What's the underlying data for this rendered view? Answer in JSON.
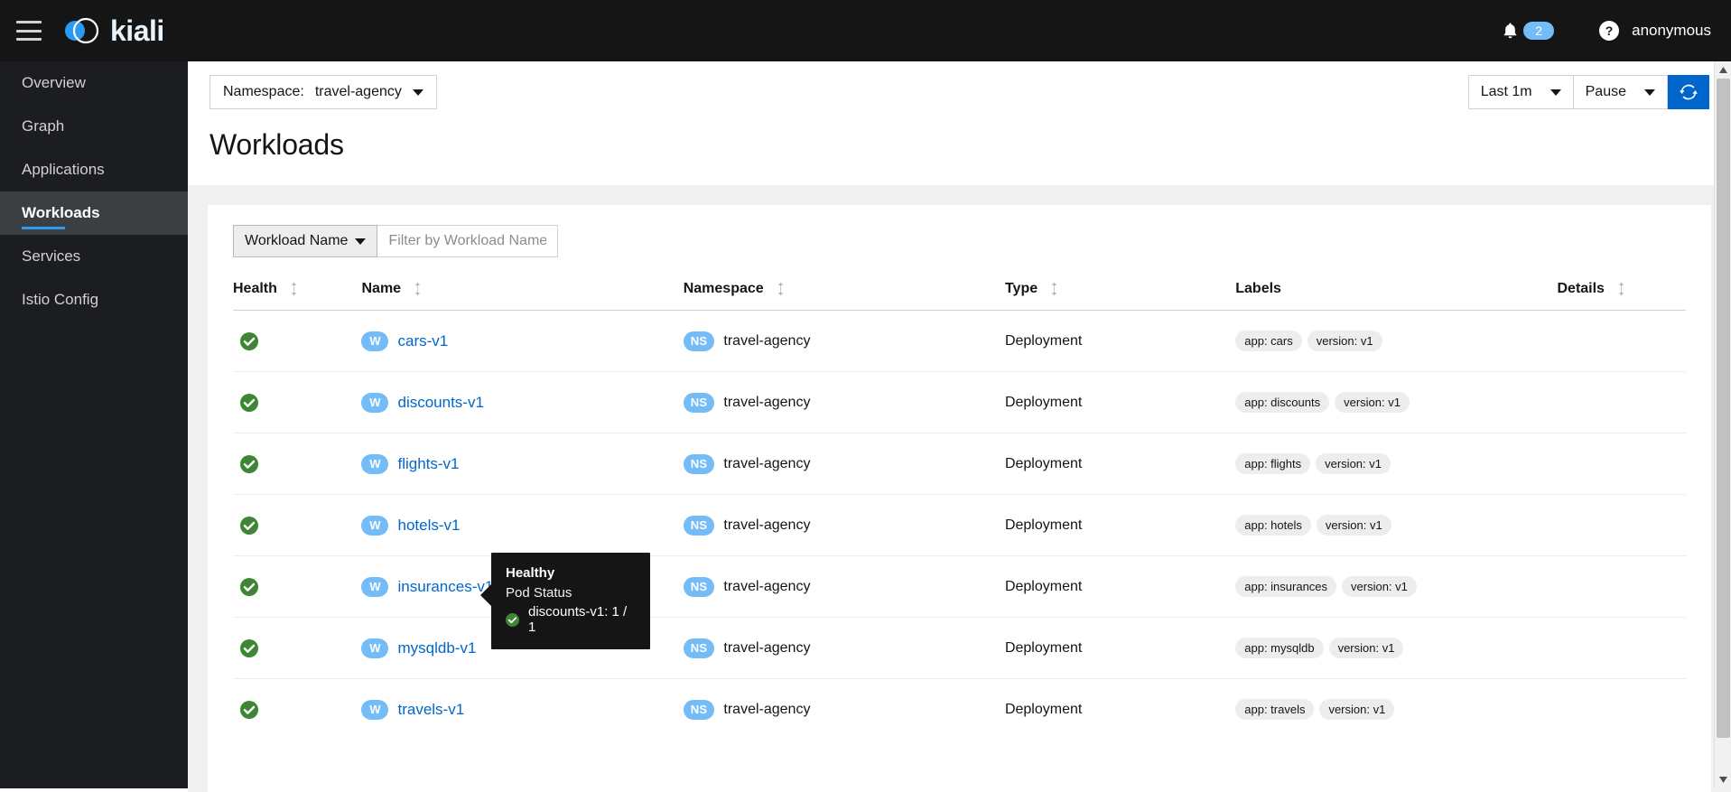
{
  "masthead": {
    "menu_icon": "hamburger-icon",
    "brand": "kiali",
    "notifications": {
      "icon": "bell-icon",
      "count": "2"
    },
    "help_icon": "question-circle-icon",
    "user": "anonymous"
  },
  "sidebar": {
    "items": [
      {
        "label": "Overview",
        "active": false
      },
      {
        "label": "Graph",
        "active": false
      },
      {
        "label": "Applications",
        "active": false
      },
      {
        "label": "Workloads",
        "active": true
      },
      {
        "label": "Services",
        "active": false
      },
      {
        "label": "Istio Config",
        "active": false
      }
    ]
  },
  "toolbar": {
    "namespace_label": "Namespace:",
    "namespace_value": "travel-agency",
    "time_range": "Last 1m",
    "refresh_interval": "Pause",
    "refresh_icon": "sync-icon"
  },
  "page": {
    "title": "Workloads"
  },
  "filter": {
    "type_label": "Workload Name",
    "placeholder": "Filter by Workload Name",
    "value": ""
  },
  "table": {
    "columns": [
      {
        "label": "Health",
        "sortable": true
      },
      {
        "label": "Name",
        "sortable": true
      },
      {
        "label": "Namespace",
        "sortable": true
      },
      {
        "label": "Type",
        "sortable": true
      },
      {
        "label": "Labels",
        "sortable": false
      },
      {
        "label": "Details",
        "sortable": true
      }
    ],
    "rows": [
      {
        "health": "healthy",
        "badge": "W",
        "name": "cars-v1",
        "ns_badge": "NS",
        "namespace": "travel-agency",
        "type": "Deployment",
        "labels": [
          "app: cars",
          "version: v1"
        ],
        "details": ""
      },
      {
        "health": "healthy",
        "badge": "W",
        "name": "discounts-v1",
        "ns_badge": "NS",
        "namespace": "travel-agency",
        "type": "Deployment",
        "labels": [
          "app: discounts",
          "version: v1"
        ],
        "details": ""
      },
      {
        "health": "healthy",
        "badge": "W",
        "name": "flights-v1",
        "ns_badge": "NS",
        "namespace": "travel-agency",
        "type": "Deployment",
        "labels": [
          "app: flights",
          "version: v1"
        ],
        "details": ""
      },
      {
        "health": "healthy",
        "badge": "W",
        "name": "hotels-v1",
        "ns_badge": "NS",
        "namespace": "travel-agency",
        "type": "Deployment",
        "labels": [
          "app: hotels",
          "version: v1"
        ],
        "details": ""
      },
      {
        "health": "healthy",
        "badge": "W",
        "name": "insurances-v1",
        "ns_badge": "NS",
        "namespace": "travel-agency",
        "type": "Deployment",
        "labels": [
          "app: insurances",
          "version: v1"
        ],
        "details": ""
      },
      {
        "health": "healthy",
        "badge": "W",
        "name": "mysqldb-v1",
        "ns_badge": "NS",
        "namespace": "travel-agency",
        "type": "Deployment",
        "labels": [
          "app: mysqldb",
          "version: v1"
        ],
        "details": ""
      },
      {
        "health": "healthy",
        "badge": "W",
        "name": "travels-v1",
        "ns_badge": "NS",
        "namespace": "travel-agency",
        "type": "Deployment",
        "labels": [
          "app: travels",
          "version: v1"
        ],
        "details": ""
      }
    ]
  },
  "tooltip": {
    "title": "Healthy",
    "subtitle": "Pod Status",
    "pod_status": "discounts-v1: 1 / 1",
    "status_icon": "check-circle-icon"
  },
  "colors": {
    "masthead_bg": "#151515",
    "sidebar_bg": "#1b1d21",
    "sidebar_active_bg": "#3c3f42",
    "accent_blue": "#2b9af3",
    "link_blue": "#0066cc",
    "badge_blue": "#73bcf7",
    "healthy_green": "#3e8635",
    "tooltip_bg": "#151515"
  }
}
